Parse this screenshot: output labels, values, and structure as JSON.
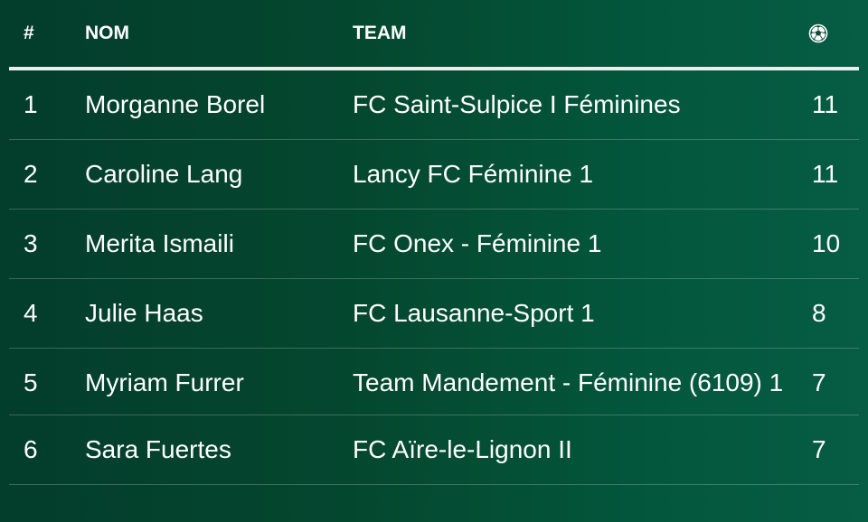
{
  "table": {
    "headers": {
      "rank": "#",
      "name": "NOM",
      "team": "TEAM",
      "goals_icon": "soccer-ball-icon"
    },
    "rows": [
      {
        "rank": "1",
        "name": "Morganne Borel",
        "team": "FC Saint-Sulpice I Féminines",
        "goals": "11"
      },
      {
        "rank": "2",
        "name": "Caroline Lang",
        "team": "Lancy FC Féminine 1",
        "goals": "11"
      },
      {
        "rank": "3",
        "name": "Merita Ismaili",
        "team": "FC Onex - Féminine 1",
        "goals": "10"
      },
      {
        "rank": "4",
        "name": "Julie Haas",
        "team": "FC Lausanne-Sport 1",
        "goals": "8"
      },
      {
        "rank": "5",
        "name": "Myriam Furrer",
        "team": "Team Mandement - Féminine (6109) 1",
        "goals": "7"
      },
      {
        "rank": "6",
        "name": "Sara Fuertes",
        "team": "FC Aïre-le-Lignon II",
        "goals": "7"
      }
    ]
  },
  "colors": {
    "background_start": "#033d2c",
    "background_end": "#065d43",
    "text": "#ffffff",
    "header_rule": "#e8eeec"
  }
}
